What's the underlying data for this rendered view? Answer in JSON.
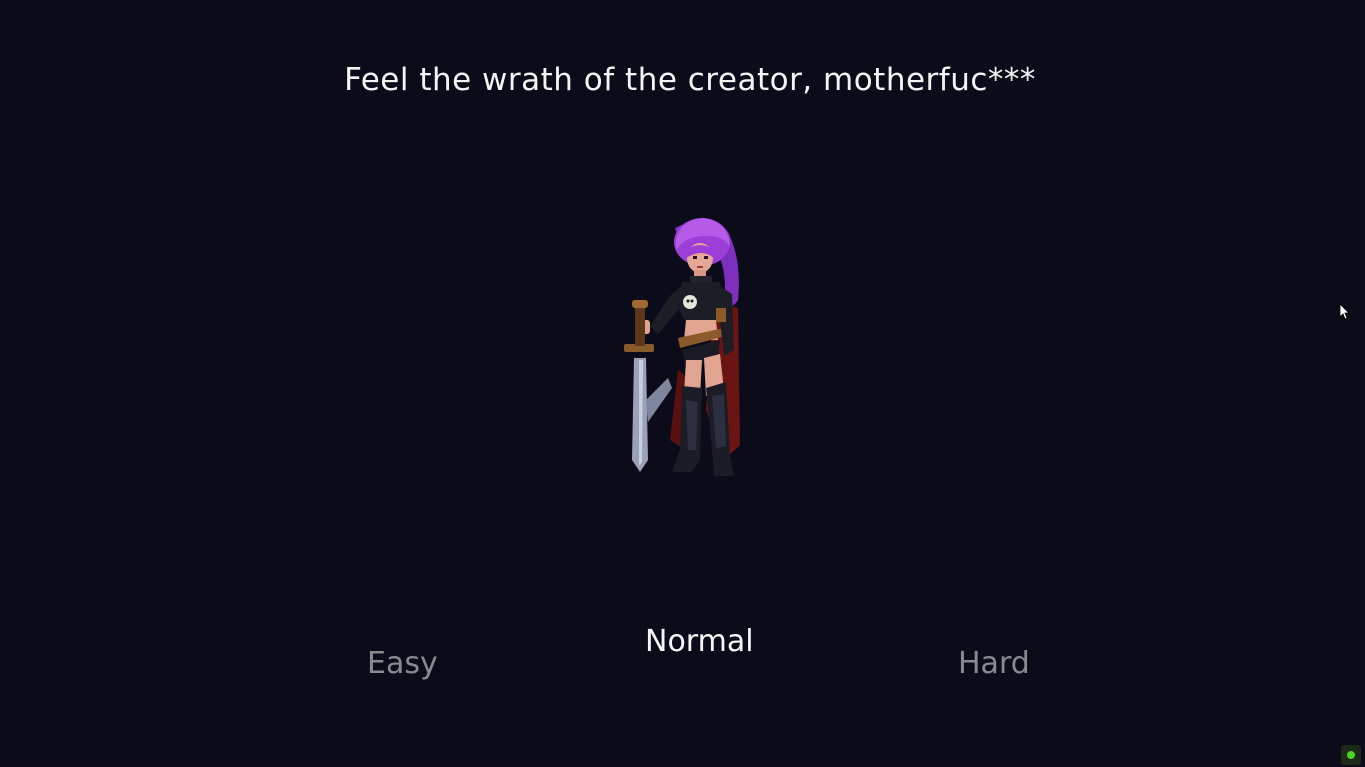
{
  "headline": "Feel the wrath of the creator, motherfuc***",
  "character": {
    "sprite": "purple-haired-warrior-with-sword",
    "hair_color": "#9b3fd8",
    "cape_color": "#6b1414"
  },
  "difficulty": {
    "options": [
      "Easy",
      "Normal",
      "Hard"
    ],
    "selected": "Normal",
    "selected_color": "#f6f6f6",
    "unselected_color": "#8a8a8e"
  },
  "background_color": "#0b0b19",
  "system_tray": {
    "icon": "status-indicator-icon",
    "color": "#4fd329"
  }
}
